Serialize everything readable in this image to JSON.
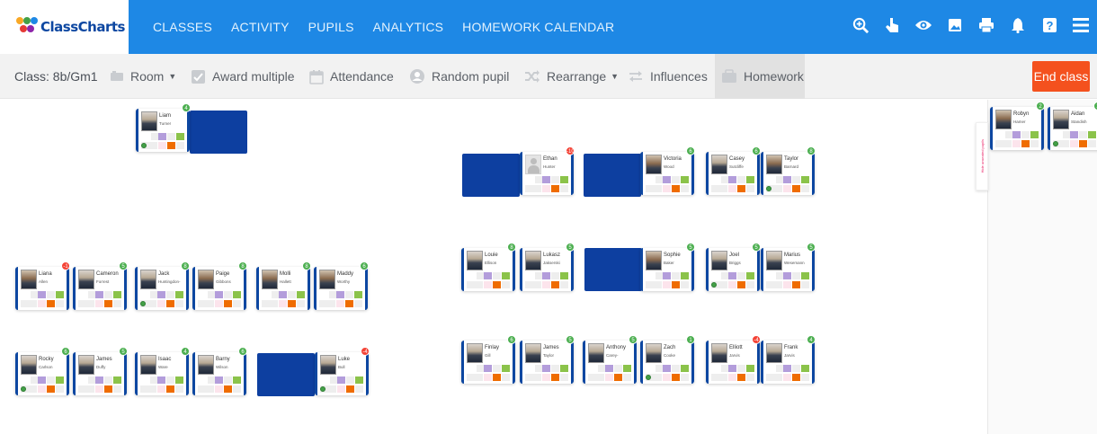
{
  "logo": {
    "text": "ClassCharts"
  },
  "nav": {
    "links": [
      "CLASSES",
      "ACTIVITY",
      "PUPILS",
      "ANALYTICS",
      "HOMEWORK CALENDAR"
    ]
  },
  "nav_icons": [
    "zoom-in-icon",
    "pointer-icon",
    "eye-icon",
    "image-icon",
    "print-icon",
    "bell-icon",
    "help-icon",
    "menu-icon"
  ],
  "toolbar": {
    "class_label": "Class: 8b/Gm1",
    "room": "Room",
    "award_multiple": "Award multiple",
    "attendance": "Attendance",
    "random_pupil": "Random pupil",
    "rearrange": "Rearrange",
    "influences": "Influences",
    "homework": "Homework",
    "end_class": "End class"
  },
  "hide_panel": {
    "label": "Hide unseated pupils"
  },
  "colors": {
    "nav": "#1e88e5",
    "seat": "#0d3fa0",
    "end_class": "#f4511e",
    "positive": "#4caf50",
    "negative": "#f44336"
  },
  "pupils": [
    {
      "first": "Liam",
      "last": "Turner",
      "score": "4",
      "neg": false,
      "girl": false,
      "blank": false
    },
    {
      "first": "Ethan",
      "last": "Hunter",
      "score": "-10",
      "neg": true,
      "girl": false,
      "blank": true
    },
    {
      "first": "Victoria",
      "last": "Wood",
      "score": "6",
      "neg": false,
      "girl": true,
      "blank": false
    },
    {
      "first": "Casey",
      "last": "Sutcliffe",
      "score": "6",
      "neg": false,
      "girl": false,
      "blank": false
    },
    {
      "first": "Taylor",
      "last": "Barnard",
      "score": "8",
      "neg": false,
      "girl": true,
      "blank": false
    },
    {
      "first": "Louie",
      "last": "Ellison",
      "score": "8",
      "neg": false,
      "girl": false,
      "blank": false
    },
    {
      "first": "Lukasz",
      "last": "Jakserski",
      "score": "5",
      "neg": false,
      "girl": false,
      "blank": false
    },
    {
      "first": "Sophie",
      "last": "Baker",
      "score": "5",
      "neg": false,
      "girl": true,
      "blank": false
    },
    {
      "first": "Joel",
      "last": "Briggs",
      "score": "5",
      "neg": false,
      "girl": false,
      "blank": false
    },
    {
      "first": "Marius",
      "last": "Wesemann",
      "score": "5",
      "neg": false,
      "girl": false,
      "blank": false
    },
    {
      "first": "Liana",
      "last": "Allen",
      "score": "-1",
      "neg": true,
      "girl": true,
      "blank": false
    },
    {
      "first": "Cameron",
      "last": "Forrest",
      "score": "5",
      "neg": false,
      "girl": false,
      "blank": false
    },
    {
      "first": "Jack",
      "last": "Huntingdon-",
      "score": "8",
      "neg": false,
      "girl": false,
      "blank": false
    },
    {
      "first": "Paige",
      "last": "Gibbons",
      "score": "8",
      "neg": false,
      "girl": true,
      "blank": false
    },
    {
      "first": "Molli",
      "last": "Hallett",
      "score": "8",
      "neg": false,
      "girl": true,
      "blank": false
    },
    {
      "first": "Maddy",
      "last": "Worthy",
      "score": "6",
      "neg": false,
      "girl": true,
      "blank": false
    },
    {
      "first": "Rocky",
      "last": "Carlson",
      "score": "6",
      "neg": false,
      "girl": false,
      "blank": false
    },
    {
      "first": "James",
      "last": "Duffy",
      "score": "5",
      "neg": false,
      "girl": false,
      "blank": false
    },
    {
      "first": "Isaac",
      "last": "Ware",
      "score": "4",
      "neg": false,
      "girl": false,
      "blank": false
    },
    {
      "first": "Barny",
      "last": "Wilson",
      "score": "6",
      "neg": false,
      "girl": false,
      "blank": false
    },
    {
      "first": "Luke",
      "last": "Bull",
      "score": "-4",
      "neg": true,
      "girl": false,
      "blank": false
    },
    {
      "first": "Finlay",
      "last": "Gill",
      "score": "6",
      "neg": false,
      "girl": false,
      "blank": false
    },
    {
      "first": "James",
      "last": "Taylor",
      "score": "5",
      "neg": false,
      "girl": false,
      "blank": false
    },
    {
      "first": "Anthony",
      "last": "Carey-",
      "score": "5",
      "neg": false,
      "girl": false,
      "blank": false
    },
    {
      "first": "Zach",
      "last": "Cooke",
      "score": "1",
      "neg": false,
      "girl": false,
      "blank": false
    },
    {
      "first": "Elliott",
      "last": "Jarvis",
      "score": "-4",
      "neg": true,
      "girl": false,
      "blank": false
    },
    {
      "first": "Frank",
      "last": "Jarvis",
      "score": "4",
      "neg": false,
      "girl": false,
      "blank": false
    },
    {
      "first": "Robyn",
      "last": "Hamer",
      "score": "2",
      "neg": false,
      "girl": true,
      "blank": false
    },
    {
      "first": "Aidan",
      "last": "Standish",
      "score": "2",
      "neg": false,
      "girl": false,
      "blank": false
    }
  ]
}
